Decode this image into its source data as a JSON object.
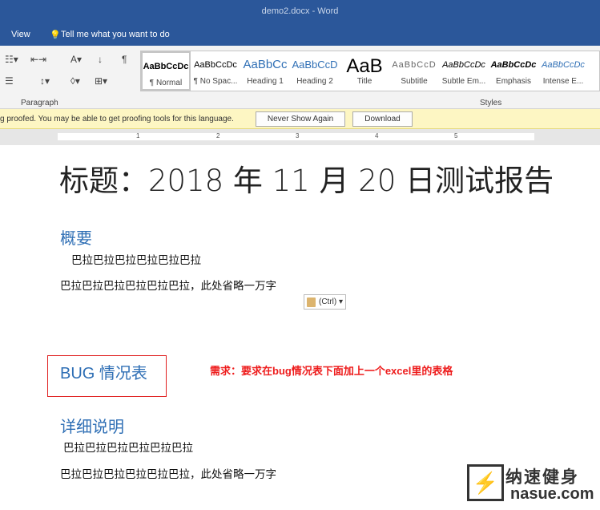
{
  "window": {
    "title": "demo2.docx  -  Word"
  },
  "tabs": {
    "view": "View",
    "tell_me": "Tell me what you want to do"
  },
  "ribbon": {
    "paragraph_label": "Paragraph",
    "styles_label": "Styles",
    "styles": [
      {
        "sample": "AaBbCcDc",
        "label": "¶ Normal",
        "selected": true
      },
      {
        "sample": "AaBbCcDc",
        "label": "¶ No Spac..."
      },
      {
        "sample": "AaBbCc",
        "label": "Heading 1"
      },
      {
        "sample": "AaBbCcD",
        "label": "Heading 2"
      },
      {
        "sample": "AaB",
        "label": "Title"
      },
      {
        "sample": "AaBbCcD",
        "label": "Subtitle"
      },
      {
        "sample": "AaBbCcDc",
        "label": "Subtle Em..."
      },
      {
        "sample": "AaBbCcDc",
        "label": "Emphasis"
      },
      {
        "sample": "AaBbCcDc",
        "label": "Intense E..."
      }
    ]
  },
  "message_bar": {
    "text": "g proofed. You may be able to get proofing tools for this language.",
    "never_show": "Never Show Again",
    "download": "Download"
  },
  "ruler": {
    "numbers": [
      "1",
      "2",
      "3",
      "4",
      "5"
    ]
  },
  "document": {
    "title": "标题：2018 年 11 月 20 日测试报告",
    "h_summary": "概要",
    "p1": "巴拉巴拉巴拉巴拉巴拉巴拉",
    "p2": "巴拉巴拉巴拉巴拉巴拉巴拉，此处省略一万字",
    "paste_options": "(Ctrl)",
    "h_bug": "BUG 情况表",
    "note": "需求：要求在bug情况表下面加上一个excel里的表格",
    "h_detail": "详细说明",
    "p3": "巴拉巴拉巴拉巴拉巴拉巴拉",
    "p4": "巴拉巴拉巴拉巴拉巴拉巴拉，此处省略一万字"
  },
  "watermark": {
    "cn": "纳速健身",
    "en": "nasue.com"
  }
}
